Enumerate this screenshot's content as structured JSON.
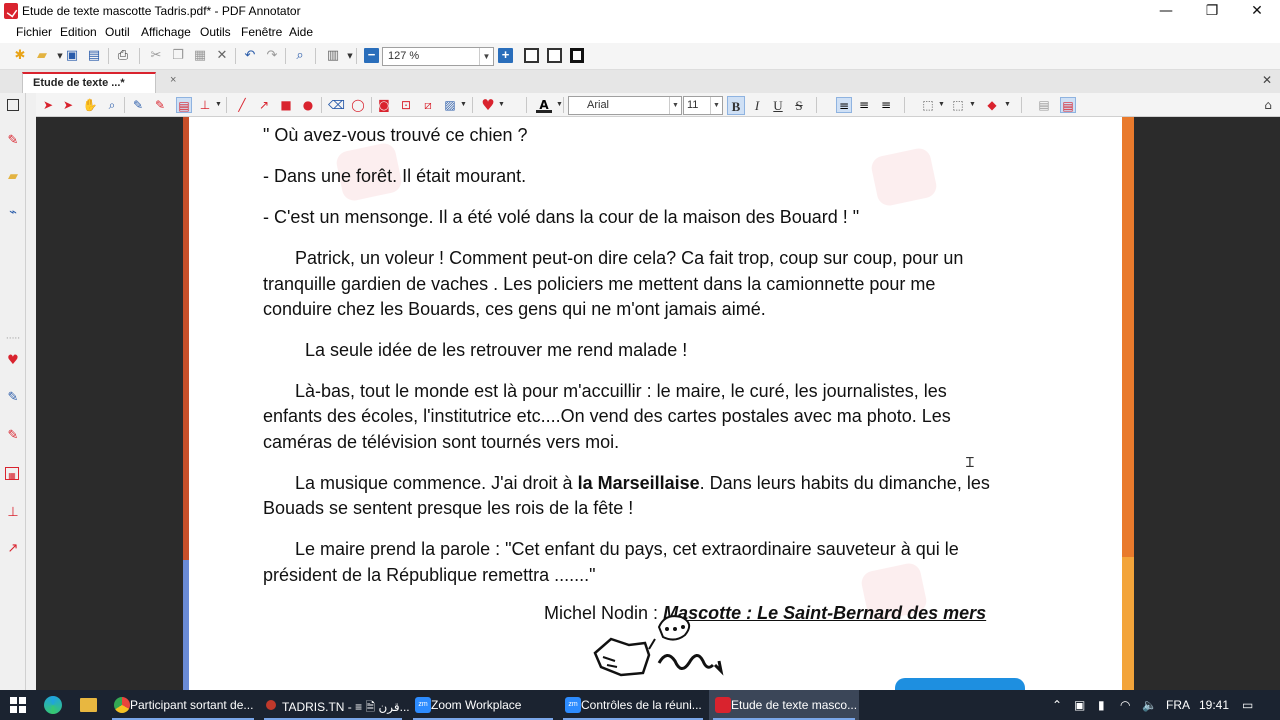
{
  "window": {
    "title": "Etude de texte mascotte Tadris.pdf* - PDF Annotator",
    "minimize": "—",
    "maximize": "❐",
    "close": "✕"
  },
  "menu": [
    "Fichier",
    "Edition",
    "Outil",
    "Affichage",
    "Outils",
    "Fenêtre",
    "Aide"
  ],
  "toolbar": {
    "zoom_value": "127 %"
  },
  "tab": {
    "label": "Etude de texte ...*",
    "close": "×"
  },
  "annotation_toolbar": {
    "font_name": "Arial",
    "font_size": "11",
    "bold": "B",
    "italic": "I",
    "underline": "U",
    "strike": "S"
  },
  "document": {
    "paragraphs": [
      "\" Où avez-vous trouvé ce chien ?",
      "- Dans une forêt. Il était mourant.",
      "- C'est un mensonge. Il a été volé dans la cour de la maison des Bouard ! \"",
      "Patrick, un voleur ! Comment peut-on dire cela? Ca fait trop, coup sur coup, pour un",
      "tranquille gardien de vaches . Les policiers me mettent dans la camionnette pour me",
      "conduire chez les Bouards, ces gens qui ne m'ont jamais aimé.",
      "La seule idée de les retrouver me rend malade !",
      "Là-bas, tout le monde est là pour m'accuillir : le maire, le curé, les journalistes, les",
      "enfants des écoles, l'institutrice etc....On vend des cartes postales avec ma photo. Les",
      "caméras de télévision sont tournés vers moi.",
      "Bouads se sentent presque les rois de la fête !",
      "Le maire prend la parole : \"Cet enfant du pays, cet extraordinaire sauveteur à qui le",
      "président de la République remettra .......\""
    ],
    "musique_before": "La musique commence. J'ai droit à ",
    "musique_bold": "la Marseillaise",
    "musique_after": ". Dans leurs habits du dimanche, les",
    "signature_author": "Michel Nodin : ",
    "signature_title": "Mascotte : Le Saint-Bernard des mers"
  },
  "taskbar": {
    "items": [
      {
        "label": "Participant sortant de...",
        "color": "#e8453c"
      },
      {
        "label": "TADRIS.TN - ≡ 🗎 قرن...",
        "color": "#c0392b"
      },
      {
        "label": "Zoom Workplace",
        "color": "#2d8cff"
      },
      {
        "label": "Contrôles de la réuni...",
        "color": "#2d8cff"
      },
      {
        "label": "Etude de texte masco...",
        "color": "#d9232e"
      }
    ],
    "language": "FRA",
    "time": "19:41"
  }
}
